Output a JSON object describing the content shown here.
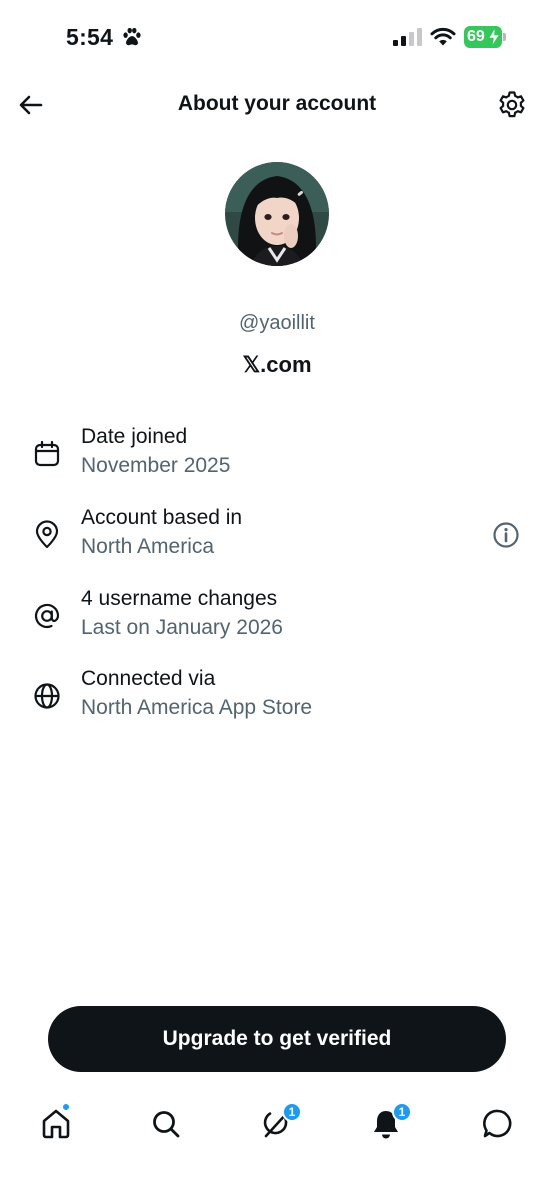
{
  "status_bar": {
    "time": "5:54",
    "battery": "69"
  },
  "header": {
    "title": "About your account"
  },
  "profile": {
    "handle": "@yaoillit",
    "site": "𝕏.com"
  },
  "info_rows": [
    {
      "icon": "calendar-icon",
      "title": "Date joined",
      "subtitle": "November 2025"
    },
    {
      "icon": "location-pin-icon",
      "title": "Account based in",
      "subtitle": "North America"
    },
    {
      "icon": "at-sign-icon",
      "title": "4 username changes",
      "subtitle": "Last on January 2026"
    },
    {
      "icon": "globe-icon",
      "title": "Connected via",
      "subtitle": "North America App Store"
    }
  ],
  "cta": {
    "label": "Upgrade to get verified"
  },
  "tab_bar": {
    "grok_badge": "1",
    "notifications_badge": "1"
  },
  "colors": {
    "accent": "#1d9bf0",
    "text_primary": "#0f1419",
    "text_secondary": "#536471",
    "battery": "#34c759"
  }
}
